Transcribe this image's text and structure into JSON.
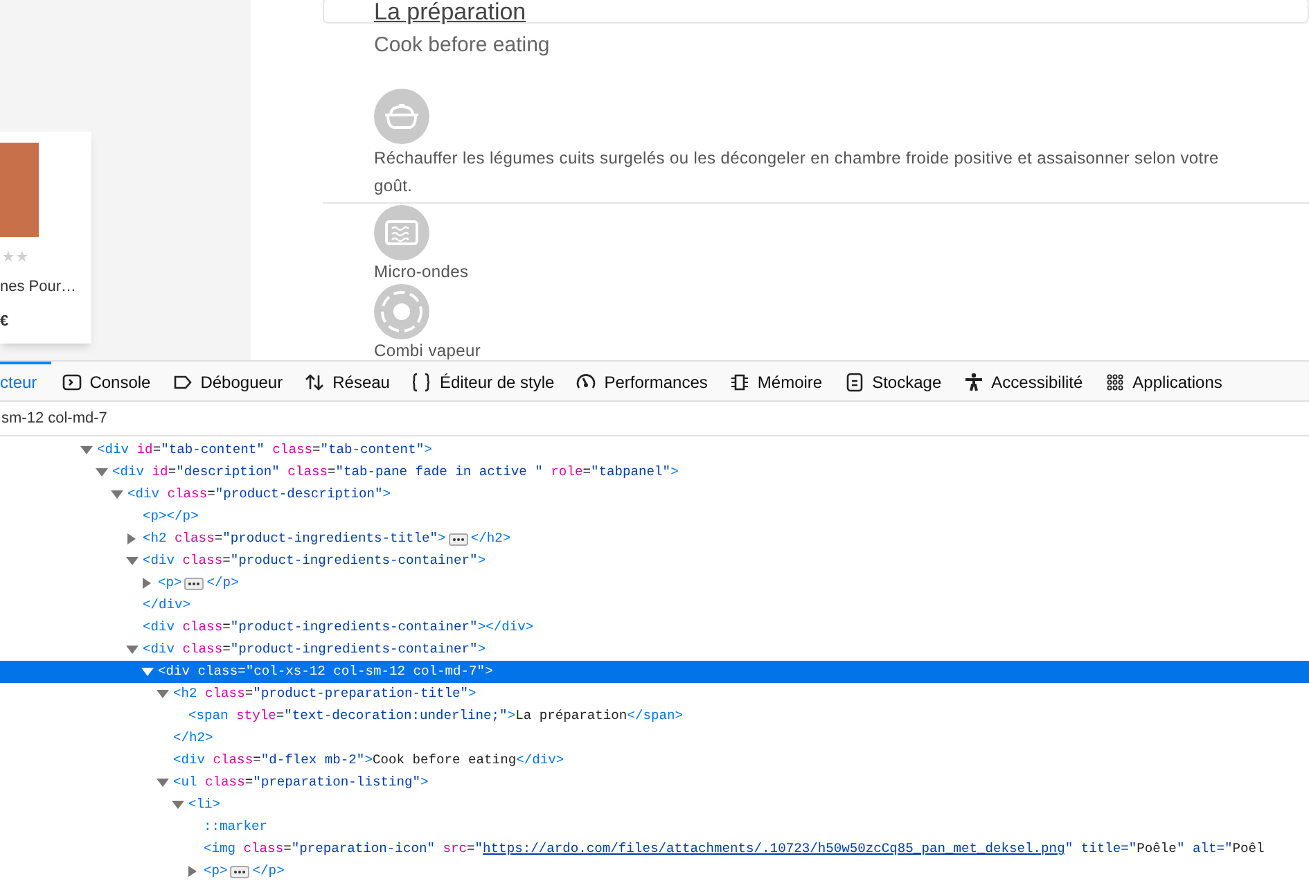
{
  "product_card": {
    "name": "nes Pour…",
    "price": "€"
  },
  "preparation": {
    "title": "La préparation",
    "subtitle": "Cook before eating",
    "methods": [
      {
        "kind": "pan",
        "text": "Réchauffer les légumes cuits surgelés ou les décongeler en chambre froide positive et assaisonner selon votre goût."
      },
      {
        "kind": "microwave",
        "text": "Micro-ondes"
      },
      {
        "kind": "steam",
        "text": "Combi vapeur"
      }
    ]
  },
  "devtools": {
    "tabs": [
      {
        "kind": "inspector",
        "label": "cteur",
        "selected": true
      },
      {
        "kind": "console",
        "label": "Console",
        "selected": false
      },
      {
        "kind": "debugger",
        "label": "Débogueur",
        "selected": false
      },
      {
        "kind": "network",
        "label": "Réseau",
        "selected": false
      },
      {
        "kind": "style",
        "label": "Éditeur de style",
        "selected": false
      },
      {
        "kind": "performance",
        "label": "Performances",
        "selected": false
      },
      {
        "kind": "memory",
        "label": "Mémoire",
        "selected": false
      },
      {
        "kind": "storage",
        "label": "Stockage",
        "selected": false
      },
      {
        "kind": "accessibility",
        "label": "Accessibilité",
        "selected": false
      },
      {
        "kind": "applications",
        "label": "Applications",
        "selected": false
      }
    ],
    "breadcrumb": "sm-12 col-md-7",
    "tree": [
      {
        "text": "<div id=\"tab-content\" class=\"tab-content\">",
        "expanded": true,
        "selected": false,
        "children": [
          {
            "text": "<div id=\"description\" class=\"tab-pane fade in active \" role=\"tabpanel\">",
            "expanded": true,
            "selected": false,
            "children": [
              {
                "text": "<div class=\"product-description\">",
                "expanded": true,
                "selected": false,
                "children": [
                  {
                    "text": "<p></p>",
                    "selected": false
                  },
                  {
                    "text": "<h2 class=\"product-ingredients-title\">",
                    "text_after": "</h2>",
                    "expanded": false,
                    "selected": false
                  },
                  {
                    "text": "<div class=\"product-ingredients-container\">",
                    "expanded": true,
                    "selected": false,
                    "children": [
                      {
                        "text": "<p>",
                        "text_after": "</p>",
                        "expanded": false,
                        "selected": false
                      }
                    ]
                  },
                  {
                    "text": "</div>",
                    "selected": false
                  },
                  {
                    "text": "<div class=\"product-ingredients-container\"></div>",
                    "selected": false
                  },
                  {
                    "text": "<div class=\"product-ingredients-container\">",
                    "expanded": true,
                    "selected": false,
                    "children": [
                      {
                        "text": "<div class=\"col-xs-12 col-sm-12 col-md-7\">",
                        "expanded": true,
                        "selected": true,
                        "children": [
                          {
                            "text": "<h2 class=\"product-preparation-title\">",
                            "expanded": true,
                            "selected": false,
                            "children": [
                              {
                                "text": "<span style=\"text-decoration:underline;\">La préparation</span>",
                                "selected": false
                              }
                            ]
                          },
                          {
                            "text": "</h2>",
                            "selected": false
                          },
                          {
                            "text": "<div class=\"d-flex mb-2\">Cook before eating</div>",
                            "selected": false
                          },
                          {
                            "text": "<ul class=\"preparation-listing\">",
                            "expanded": true,
                            "selected": false,
                            "children": [
                              {
                                "text": "<li>",
                                "expanded": true,
                                "selected": false,
                                "children": [
                                  {
                                    "text": "::marker",
                                    "selected": false
                                  },
                                  {
                                    "text": "<img class=\"preparation-icon\" src=\"",
                                    "link": "https://ardo.com/files/attachments/.10723/h50w50zcCq85_pan_met_deksel.png",
                                    "text_after": "\" title=\"Poêle\" alt=\"Poêl",
                                    "selected": false
                                  },
                                  {
                                    "text": "<p>",
                                    "text_after": "</p>",
                                    "expanded": false,
                                    "selected": false
                                  }
                                ]
                              }
                            ]
                          }
                        ]
                      }
                    ]
                  }
                ]
              }
            ]
          }
        ]
      }
    ]
  }
}
